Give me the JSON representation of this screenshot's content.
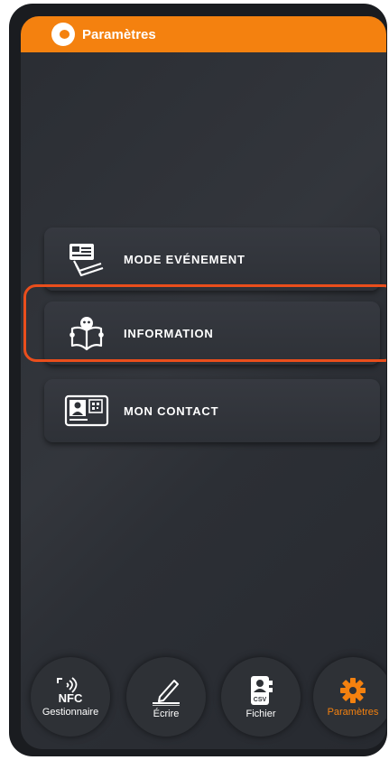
{
  "header": {
    "title": "Paramètres"
  },
  "menu": [
    {
      "label": "MODE EVÉNEMENT",
      "icon": "card-stack-icon"
    },
    {
      "label": "INFORMATION",
      "icon": "book-reader-icon"
    },
    {
      "label": "MON CONTACT",
      "icon": "contact-card-icon"
    }
  ],
  "nav": {
    "nfc_text": "NFC",
    "items": [
      {
        "label": "Gestionnaire",
        "icon": "nfc-icon"
      },
      {
        "label": "Écrire",
        "icon": "pen-icon"
      },
      {
        "label": "Fichier",
        "icon": "csv-contact-icon",
        "icon_text": "CSV"
      },
      {
        "label": "Paramètres",
        "icon": "gear-icon",
        "active": true
      }
    ]
  },
  "colors": {
    "accent": "#f4810f",
    "highlight": "#ea4e1c",
    "background": "#2e3137"
  }
}
